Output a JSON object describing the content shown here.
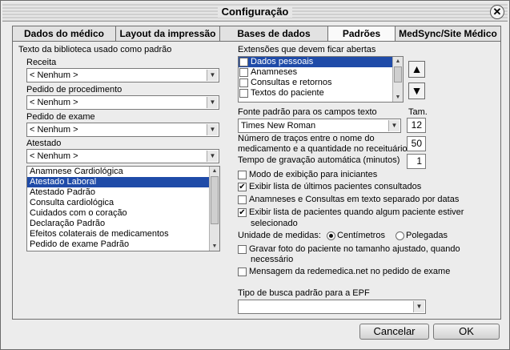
{
  "window": {
    "title": "Configuração"
  },
  "tabs": [
    {
      "label": "Dados do médico"
    },
    {
      "label": "Layout da impressão"
    },
    {
      "label": "Bases de dados"
    },
    {
      "label": "Padrões"
    },
    {
      "label": "MedSync/Site Médico"
    }
  ],
  "left": {
    "section_label": "Texto da biblioteca usado como padrão",
    "receita": {
      "label": "Receita",
      "value": "< Nenhum >"
    },
    "pedido_procedimento": {
      "label": "Pedido de procedimento",
      "value": "< Nenhum >"
    },
    "pedido_exame": {
      "label": "Pedido de exame",
      "value": "< Nenhum >"
    },
    "atestado": {
      "label": "Atestado",
      "value": "< Nenhum >"
    },
    "atestado_options": [
      "Anamnese Cardiológica",
      "Atestado Laboral",
      "Atestado Padrão",
      "Consulta cardiológica",
      "Cuidados com o coração",
      "Declaração Padrão",
      "Efeitos colaterais de medicamentos",
      "Pedido de exame Padrão"
    ]
  },
  "right": {
    "extensions_label": "Extensões que devem ficar abertas",
    "extensions": [
      {
        "label": "Dados pessoais",
        "checked": "✔"
      },
      {
        "label": "Anamneses",
        "checked": ""
      },
      {
        "label": "Consultas e retornos",
        "checked": ""
      },
      {
        "label": "Textos do paciente",
        "checked": ""
      }
    ],
    "up_arrow": "▲",
    "down_arrow": "▼",
    "font_label": "Fonte padrão para os campos texto",
    "size_label": "Tam.",
    "font_value": "Times New Roman",
    "font_size": "12",
    "traces_label_1": "Número de traços entre o nome do",
    "traces_label_2": "medicamento e a quantidade no receituário",
    "traces_value": "50",
    "autosave_label": "Tempo de gravação automática (minutos)",
    "autosave_value": "1",
    "options": [
      {
        "label": "Modo de exibição para iniciantes",
        "checked": ""
      },
      {
        "label": "Exibir lista de últimos pacientes consultados",
        "checked": "✔"
      },
      {
        "label": "Anamneses e Consultas em texto separado por datas",
        "checked": ""
      },
      {
        "label": "Exibir lista de pacientes quando algum paciente estiver",
        "label2": "selecionado",
        "checked": "✔"
      }
    ],
    "units_label": "Unidade de medidas:",
    "unit_cm": "Centímetros",
    "unit_in": "Polegadas",
    "options2": [
      {
        "label": "Gravar foto do paciente no tamanho ajustado, quando",
        "label2": "necessário",
        "checked": ""
      },
      {
        "label": "Mensagem da redemedica.net no pedido de exame",
        "checked": ""
      }
    ],
    "search_label": "Tipo de busca padrão para a EPF",
    "search_value": ""
  },
  "buttons": {
    "cancel": "Cancelar",
    "ok": "OK"
  }
}
